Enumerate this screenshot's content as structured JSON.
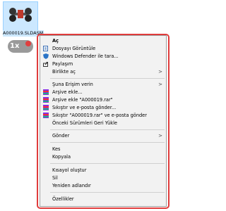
{
  "file": {
    "name": "A000019.SLDASM",
    "drag_badge": "1x"
  },
  "menu": {
    "open": "Aç",
    "view_file": "Dosyayı Görüntüle",
    "defender_scan": "Windows Defender ile tara...",
    "share": "Paylaşım",
    "open_with": "Birlikte aç",
    "give_access": "Şuna Erişim verin",
    "add_archive": "Arşive ekle...",
    "add_to_rar": "Arşive ekle \"A000019.rar\"",
    "compress_email": "Sıkıştır ve e-posta gönder...",
    "compress_rar_email": "Sıkıştır \"A000019.rar\" ve e-posta gönder",
    "restore_versions": "Önceki Sürümleri Geri Yükle",
    "send_to": "Gönder",
    "cut": "Kes",
    "copy": "Kopyala",
    "create_shortcut": "Kısayol oluştur",
    "delete": "Sil",
    "rename": "Yeniden adlandır",
    "properties": "Özellikler",
    "submenu_arrow": ">"
  },
  "colors": {
    "selection": "#cce8ff",
    "menu_bg": "#f2f2f2",
    "highlight_outline": "#e03c3c"
  }
}
